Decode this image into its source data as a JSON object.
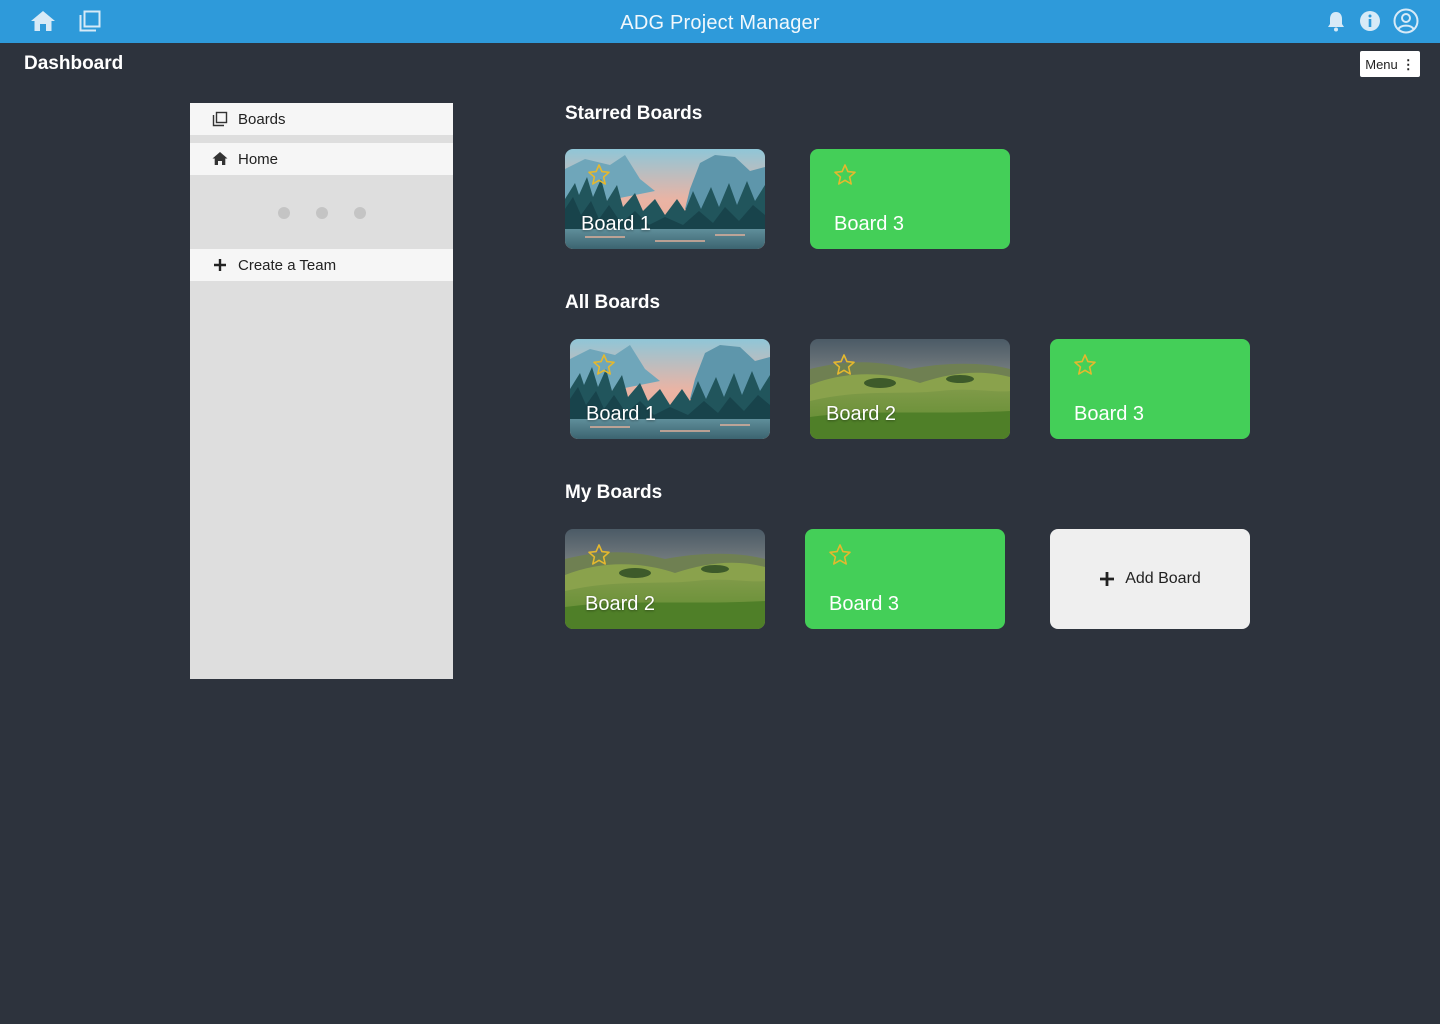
{
  "app": {
    "title": "ADG Project Manager"
  },
  "page": {
    "title": "Dashboard",
    "menu_label": "Menu"
  },
  "icons": {
    "home": "home-icon",
    "boards": "boards-icon",
    "bell": "bell-icon",
    "info": "info-icon",
    "account": "account-icon",
    "star": "star-outline-icon",
    "plus": "plus-icon"
  },
  "colors": {
    "topbar": "#2e9ada",
    "background": "#2d333d",
    "green_board": "#44cf58",
    "star": "#e5b82e"
  },
  "sidebar": {
    "items": [
      {
        "label": "Boards",
        "icon": "boards-icon"
      },
      {
        "label": "Home",
        "icon": "home-icon"
      },
      {
        "label": "Create a Team",
        "icon": "plus-icon"
      }
    ]
  },
  "sections": {
    "starred": {
      "title": "Starred Boards",
      "boards": [
        "Board 1",
        "Board 3"
      ]
    },
    "all": {
      "title": "All Boards",
      "boards": [
        "Board 1",
        "Board 2",
        "Board 3"
      ]
    },
    "mine": {
      "title": "My Boards",
      "boards": [
        "Board 2",
        "Board 3"
      ],
      "add_label": "Add Board"
    }
  }
}
